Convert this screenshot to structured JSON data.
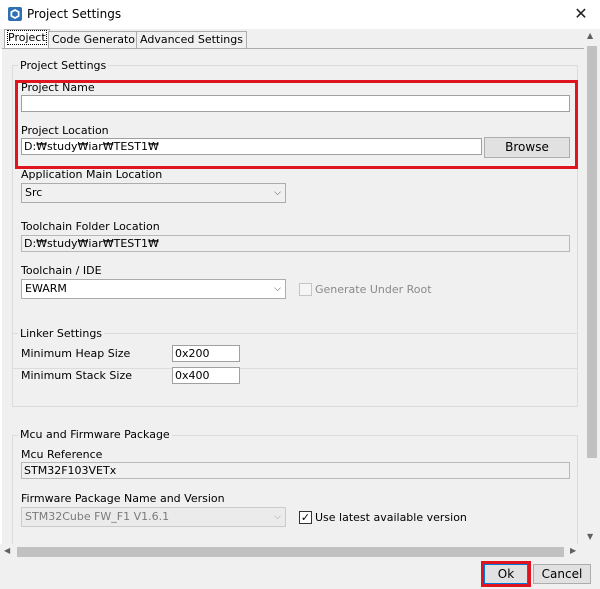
{
  "window": {
    "title": "Project Settings",
    "close_glyph": "✕",
    "icon": "cube-icon"
  },
  "tabs": [
    {
      "label": "Project",
      "active": true
    },
    {
      "label": "Code Generator",
      "active": false
    },
    {
      "label": "Advanced Settings",
      "active": false
    }
  ],
  "project_settings": {
    "group_label": "Project Settings",
    "project_name_label": "Project Name",
    "project_name_value": "",
    "project_location_label": "Project Location",
    "project_location_value": "D:₩study₩iar₩TEST1₩",
    "browse_label": "Browse",
    "app_main_location_label": "Application Main Location",
    "app_main_location_value": "Src",
    "toolchain_folder_label": "Toolchain Folder Location",
    "toolchain_folder_value": "D:₩study₩iar₩TEST1₩",
    "toolchain_ide_label": "Toolchain / IDE",
    "toolchain_ide_value": "EWARM",
    "generate_under_root_label": "Generate Under Root",
    "generate_under_root_checked": false
  },
  "linker_settings": {
    "group_label": "Linker Settings",
    "min_heap_label": "Minimum Heap Size",
    "min_heap_value": "0x200",
    "min_stack_label": "Minimum Stack Size",
    "min_stack_value": "0x400"
  },
  "mcu_firmware": {
    "group_label": "Mcu and Firmware Package",
    "mcu_reference_label": "Mcu Reference",
    "mcu_reference_value": "STM32F103VETx",
    "firmware_package_label": "Firmware Package Name and Version",
    "firmware_package_value": "STM32Cube FW_F1 V1.6.1",
    "use_latest_label": "Use latest available version",
    "use_latest_checked": true
  },
  "footer": {
    "ok_label": "Ok",
    "cancel_label": "Cancel"
  },
  "colors": {
    "highlight_red": "#e0141e",
    "dialog_bg": "#f0f0f0"
  }
}
